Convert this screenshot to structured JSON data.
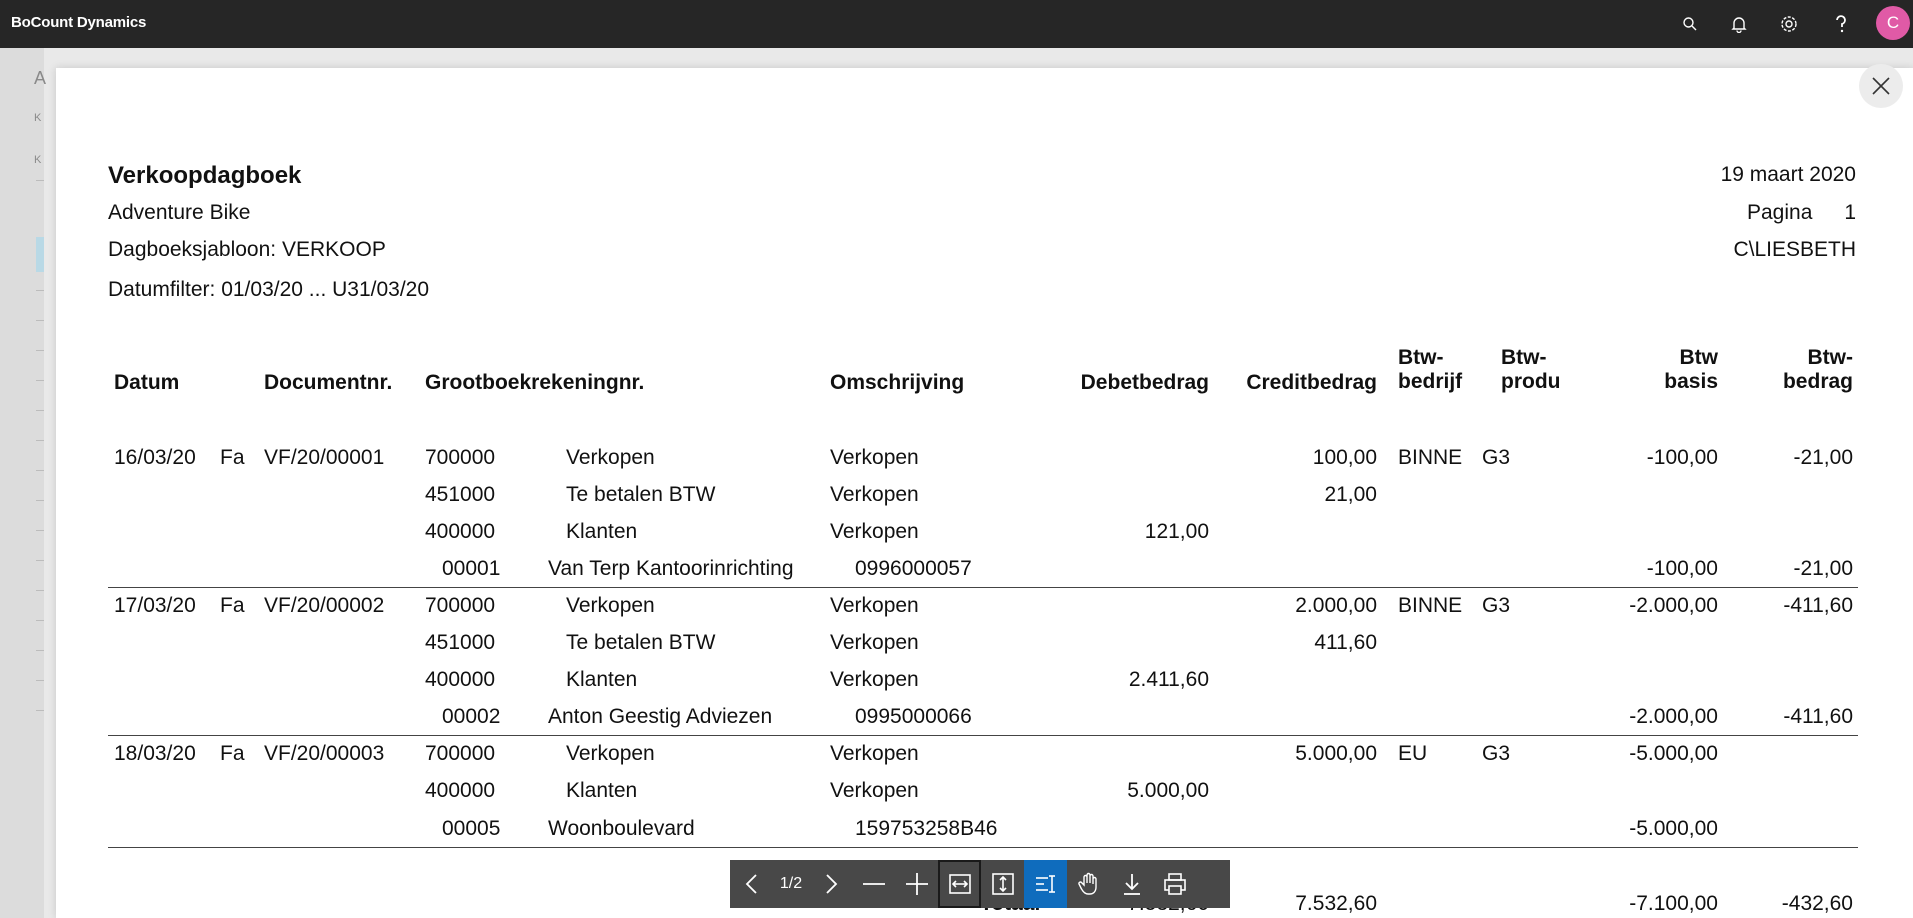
{
  "app": {
    "title": "BoCount Dynamics",
    "avatar_letter": "C",
    "icons": [
      "search-icon",
      "bell-icon",
      "gear-icon",
      "help-icon"
    ]
  },
  "background": {
    "letters": [
      "A",
      "K",
      "K"
    ]
  },
  "report": {
    "title": "Verkoopdagboek",
    "company": "Adventure Bike",
    "template": "Dagboeksjabloon: VERKOOP",
    "date_filter": "Datumfilter: 01/03/20 ... U31/03/20",
    "date": "19 maart 2020",
    "page_label": "Pagina",
    "page_number": "1",
    "user": "C\\LIESBETH",
    "columns": {
      "datum": "Datum",
      "documentnr": "Documentnr.",
      "grootboek": "Grootboekrekeningnr.",
      "omschrijving": "Omschrijving",
      "debet": "Debetbedrag",
      "credit": "Creditbedrag",
      "btw_bedrijf_1": "Btw-",
      "btw_bedrijf_2": "bedrijf",
      "btw_produ_1": "Btw-",
      "btw_produ_2": "produ",
      "btw_basis_1": "Btw",
      "btw_basis_2": "basis",
      "btw_bedrag_1": "Btw-",
      "btw_bedrag_2": "bedrag"
    },
    "lines": [
      {
        "datum": "16/03/20",
        "type": "Fa",
        "doc": "VF/20/00001",
        "account": "700000",
        "account_name": "Verkopen",
        "omschrijving": "Verkopen",
        "debet": "",
        "credit": "100,00",
        "btw_bedrijf": "BINNE",
        "btw_produ": "G3",
        "btw_basis": "-100,00",
        "btw_bedrag": "-21,00"
      },
      {
        "datum": "",
        "type": "",
        "doc": "",
        "account": "451000",
        "account_name": "Te betalen BTW",
        "omschrijving": "Verkopen",
        "debet": "",
        "credit": "21,00",
        "btw_bedrijf": "",
        "btw_produ": "",
        "btw_basis": "",
        "btw_bedrag": ""
      },
      {
        "datum": "",
        "type": "",
        "doc": "",
        "account": "400000",
        "account_name": "Klanten",
        "omschrijving": "Verkopen",
        "debet": "121,00",
        "credit": "",
        "btw_bedrijf": "",
        "btw_produ": "",
        "btw_basis": "",
        "btw_bedrag": ""
      },
      {
        "customer_no": "00001",
        "customer_name": "Van Terp Kantoorinrichting",
        "vat_no": "0996000057",
        "btw_basis": "-100,00",
        "btw_bedrag": "-21,00"
      },
      {
        "datum": "17/03/20",
        "type": "Fa",
        "doc": "VF/20/00002",
        "account": "700000",
        "account_name": "Verkopen",
        "omschrijving": "Verkopen",
        "debet": "",
        "credit": "2.000,00",
        "btw_bedrijf": "BINNE",
        "btw_produ": "G3",
        "btw_basis": "-2.000,00",
        "btw_bedrag": "-411,60"
      },
      {
        "datum": "",
        "type": "",
        "doc": "",
        "account": "451000",
        "account_name": "Te betalen BTW",
        "omschrijving": "Verkopen",
        "debet": "",
        "credit": "411,60",
        "btw_bedrijf": "",
        "btw_produ": "",
        "btw_basis": "",
        "btw_bedrag": ""
      },
      {
        "datum": "",
        "type": "",
        "doc": "",
        "account": "400000",
        "account_name": "Klanten",
        "omschrijving": "Verkopen",
        "debet": "2.411,60",
        "credit": "",
        "btw_bedrijf": "",
        "btw_produ": "",
        "btw_basis": "",
        "btw_bedrag": ""
      },
      {
        "customer_no": "00002",
        "customer_name": "Anton Geestig Adviezen",
        "vat_no": "0995000066",
        "btw_basis": "-2.000,00",
        "btw_bedrag": "-411,60"
      },
      {
        "datum": "18/03/20",
        "type": "Fa",
        "doc": "VF/20/00003",
        "account": "700000",
        "account_name": "Verkopen",
        "omschrijving": "Verkopen",
        "debet": "",
        "credit": "5.000,00",
        "btw_bedrijf": "EU",
        "btw_produ": "G3",
        "btw_basis": "-5.000,00",
        "btw_bedrag": ""
      },
      {
        "datum": "",
        "type": "",
        "doc": "",
        "account": "400000",
        "account_name": "Klanten",
        "omschrijving": "Verkopen",
        "debet": "5.000,00",
        "credit": "",
        "btw_bedrijf": "",
        "btw_produ": "",
        "btw_basis": "",
        "btw_bedrag": ""
      },
      {
        "customer_no": "00005",
        "customer_name": "Woonboulevard",
        "vat_no": "159753258B46",
        "btw_basis": "-5.000,00",
        "btw_bedrag": ""
      }
    ],
    "totals": {
      "label": "Totaal",
      "debet": "7.532,60",
      "credit": "7.532,60",
      "btw_basis": "-7.100,00",
      "btw_bedrag": "-432,60"
    }
  },
  "pdf_toolbar": {
    "page_indicator": "1/2",
    "buttons": [
      "prev-page",
      "next-page",
      "zoom-out",
      "zoom-in",
      "fit-width",
      "fit-page",
      "text-select",
      "hand-tool",
      "download",
      "print"
    ]
  }
}
